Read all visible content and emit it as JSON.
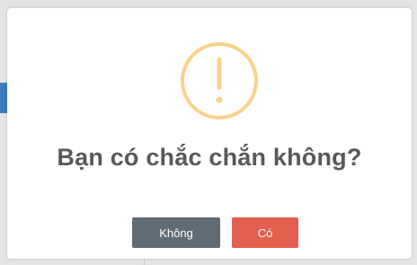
{
  "dialog": {
    "title": "Bạn có chắc chắn không?",
    "icon": "warning-exclamation-icon",
    "icon_color": "#f8d28a",
    "buttons": {
      "no_label": "Không",
      "yes_label": "Có"
    },
    "colors": {
      "no_button": "#5f6b75",
      "yes_button": "#e35f4f",
      "title_text": "#595959"
    }
  }
}
